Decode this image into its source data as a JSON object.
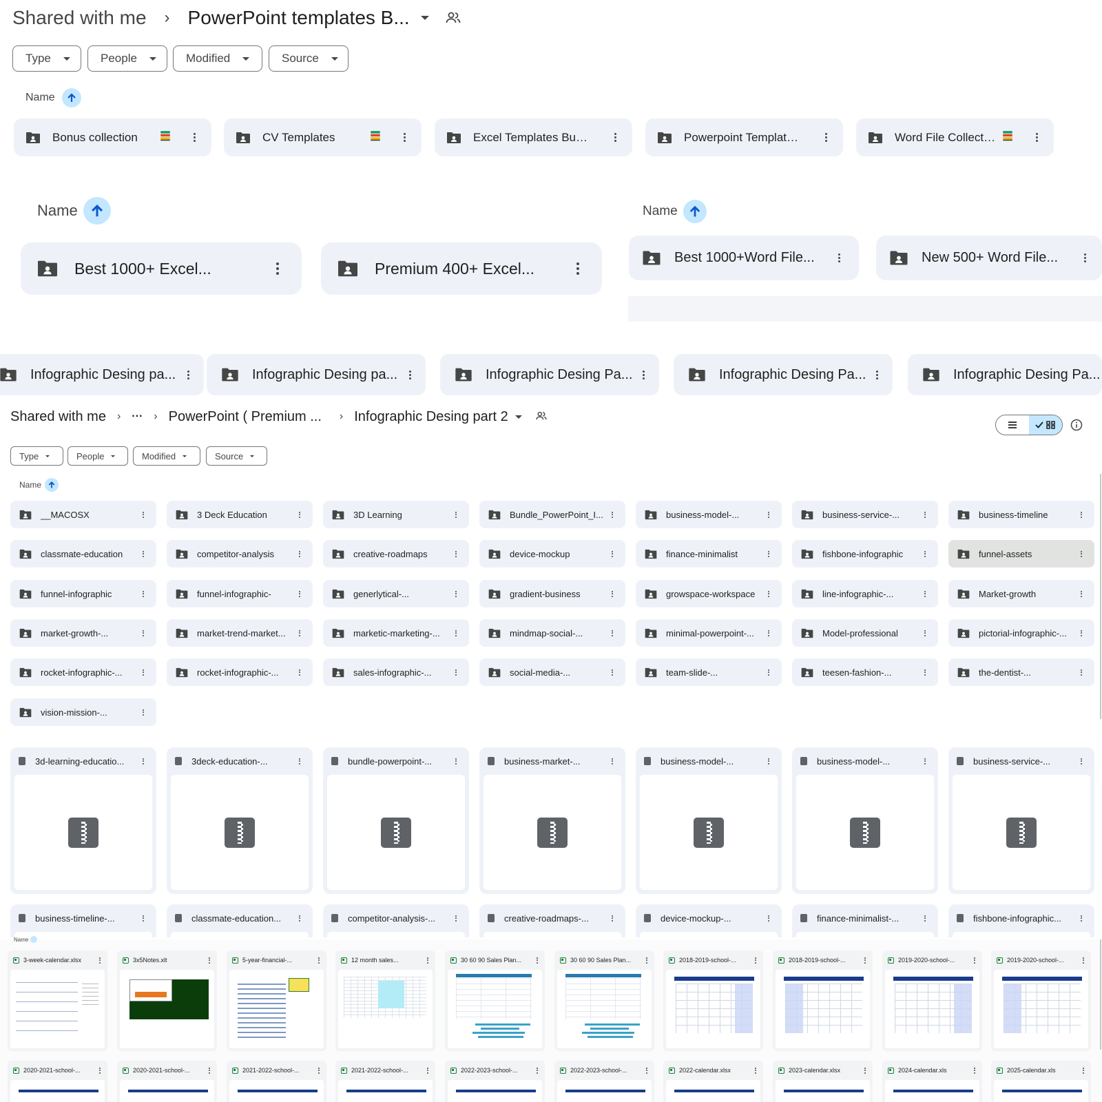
{
  "section1": {
    "breadcrumb": {
      "root": "Shared with me",
      "current": "PowerPoint templates B..."
    },
    "filters": [
      "Type",
      "People",
      "Modified",
      "Source"
    ],
    "name_header": "Name",
    "folders": [
      "Bonus collection",
      "CV Templates",
      "Excel Templates Bundl...",
      "Powerpoint Templates...",
      "Word File Collection"
    ]
  },
  "section2": {
    "name_header": "Name",
    "folders": [
      "Best 1000+ Excel...",
      "Premium 400+ Excel..."
    ]
  },
  "section2b": {
    "name_header": "Name",
    "folders": [
      "Best 1000+Word File...",
      "New 500+ Word File..."
    ]
  },
  "section3": {
    "folders": [
      "Infographic Desing pa...",
      "Infographic Desing pa...",
      "Infographic Desing Pa...",
      "Infographic Desing Pa...",
      "Infographic Desing Pa..."
    ]
  },
  "section4": {
    "breadcrumb": {
      "root": "Shared with me",
      "ellipsis": "···",
      "parent": "PowerPoint ( Premium ...",
      "current": "Infographic Desing part 2"
    },
    "filters": [
      "Type",
      "People",
      "Modified",
      "Source"
    ],
    "name_header": "Name",
    "folders": [
      "__MACOSX",
      "3 Deck Education",
      "3D Learning",
      "Bundle_PowerPoint_I...",
      "business-model-...",
      "business-service-...",
      "business-timeline",
      "classmate-education",
      "competitor-analysis",
      "creative-roadmaps",
      "device-mockup",
      "finance-minimalist",
      "fishbone-infographic",
      "funnel-assets",
      "funnel-infographic",
      "funnel-infographic-",
      "generlytical-...",
      "gradient-business",
      "growspace-workspace",
      "line-infographic-...",
      "Market-growth",
      "market-growth-...",
      "market-trend-market...",
      "marketic-marketing-...",
      "mindmap-social-...",
      "minimal-powerpoint-...",
      "Model-professional",
      "pictorial-infographic-...",
      "rocket-infographic-...",
      "rocket-infographic-...",
      "sales-infographic-...",
      "social-media-...",
      "team-slide-...",
      "teesen-fashion-...",
      "the-dentist-...",
      "vision-mission-..."
    ],
    "zip_files": [
      "3d-learning-educatio...",
      "3deck-education-...",
      "bundle-powerpoint-...",
      "business-market-...",
      "business-model-...",
      "business-model-...",
      "business-service-..."
    ],
    "zip_files_row2": [
      "business-timeline-...",
      "classmate-education...",
      "competitor-analysis-...",
      "creative-roadmaps-...",
      "device-mockup-...",
      "finance-minimalist-...",
      "fishbone-infographic..."
    ]
  },
  "section5": {
    "name_header": "Name",
    "files": [
      "3-week-calendar.xlsx",
      "3x5Notes.xlt",
      "5-year-financial-...",
      "12 month sales...",
      "30 60 90 Sales Plan...",
      "30 60 90 Sales Plan...",
      "2018-2019-school-...",
      "2018-2019-school-...",
      "2019-2020-school-...",
      "2019-2020-school-..."
    ],
    "files_row2": [
      "2020-2021-school-...",
      "2020-2021-school-...",
      "2021-2022-school-...",
      "2021-2022-school-...",
      "2022-2023-school-...",
      "2022-2023-school-...",
      "2022-calendar.xlsx",
      "2023-calendar.xlsx",
      "2024-calendar.xls",
      "2025-calendar.xls"
    ]
  },
  "colors": {
    "tile_bg": "#eef2f8",
    "sort_accent": "#c2e7ff",
    "sort_arrow": "#0b57d0",
    "text": "#1f1f1f",
    "xls_green": "#188038"
  }
}
